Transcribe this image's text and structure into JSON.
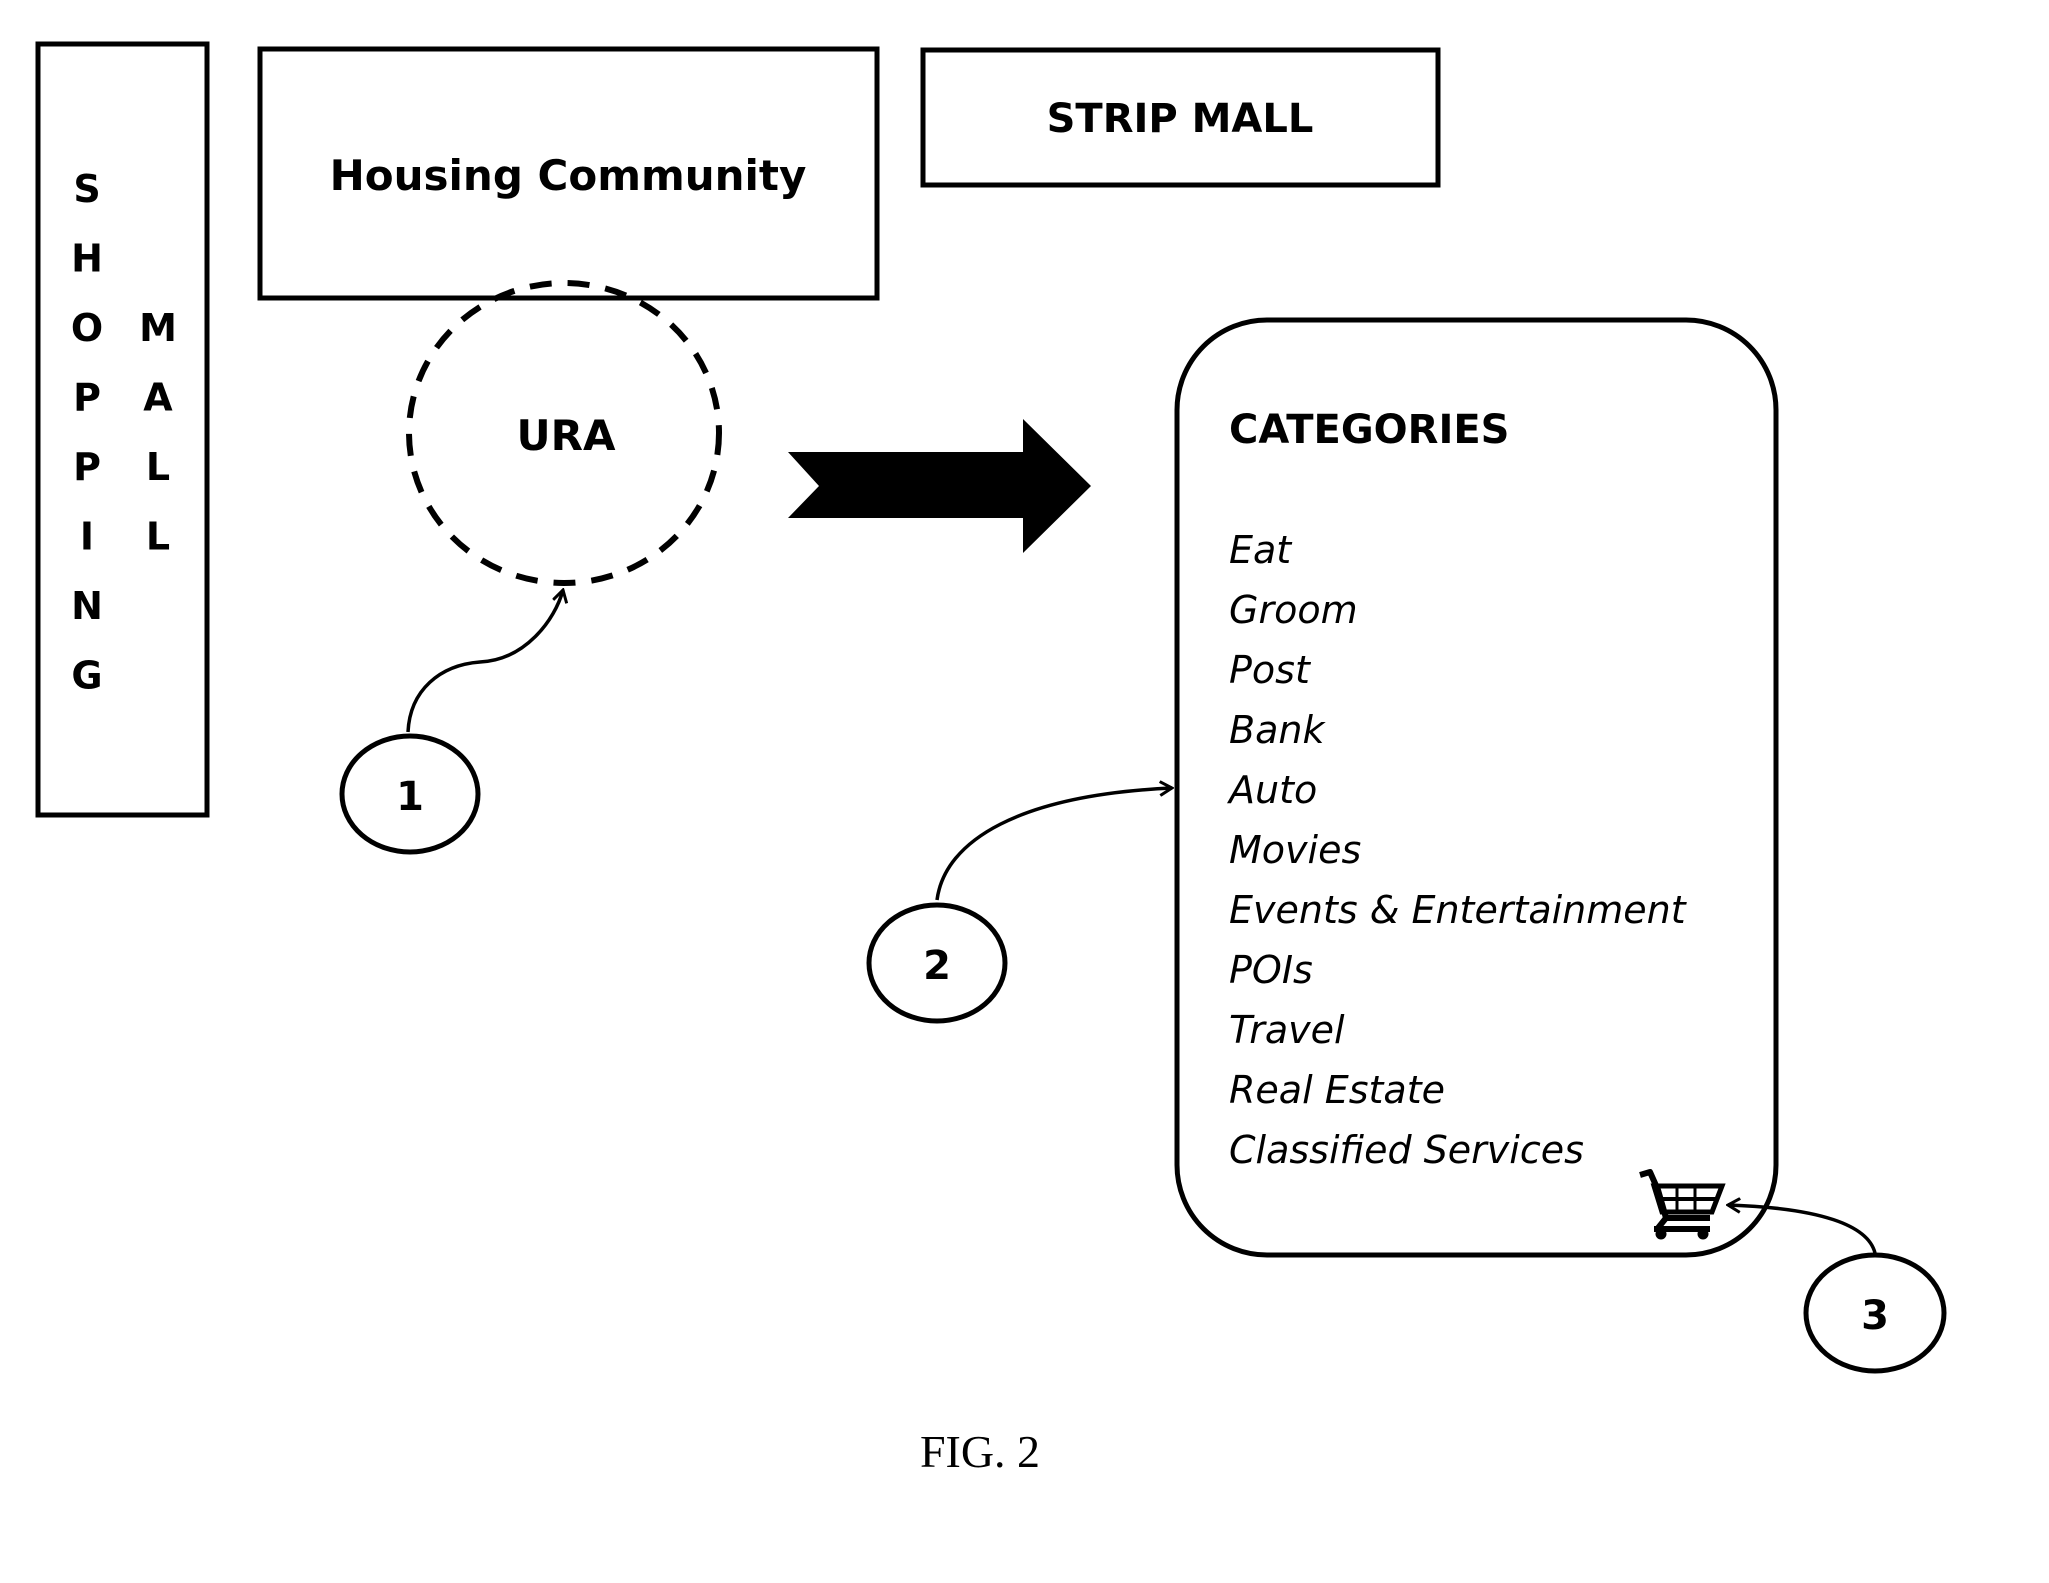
{
  "figure_label": "FIG. 2",
  "shopping_mall": {
    "label_col1": [
      "S",
      "H",
      "O",
      "P",
      "P",
      "I",
      "N",
      "G"
    ],
    "label_col2": [
      "M",
      "A",
      "L",
      "L"
    ]
  },
  "housing_community": {
    "label": "Housing Community"
  },
  "strip_mall": {
    "label": "STRIP MALL"
  },
  "ura": {
    "label": "URA"
  },
  "categories": {
    "title": "CATEGORIES",
    "items": [
      "Eat",
      "Groom",
      "Post",
      "Bank",
      "Auto",
      "Movies",
      "Events & Entertainment",
      "POIs",
      "Travel",
      "Real Estate",
      "Classified Services"
    ]
  },
  "callouts": [
    {
      "number": "1",
      "target": "URA"
    },
    {
      "number": "2",
      "target": "categories list"
    },
    {
      "number": "3",
      "target": "shopping cart icon"
    }
  ],
  "icons": {
    "cart": "shopping-cart-icon",
    "flow_arrow": "right-arrow-icon"
  },
  "colors": {
    "ink": "#000000",
    "background": "#ffffff"
  }
}
